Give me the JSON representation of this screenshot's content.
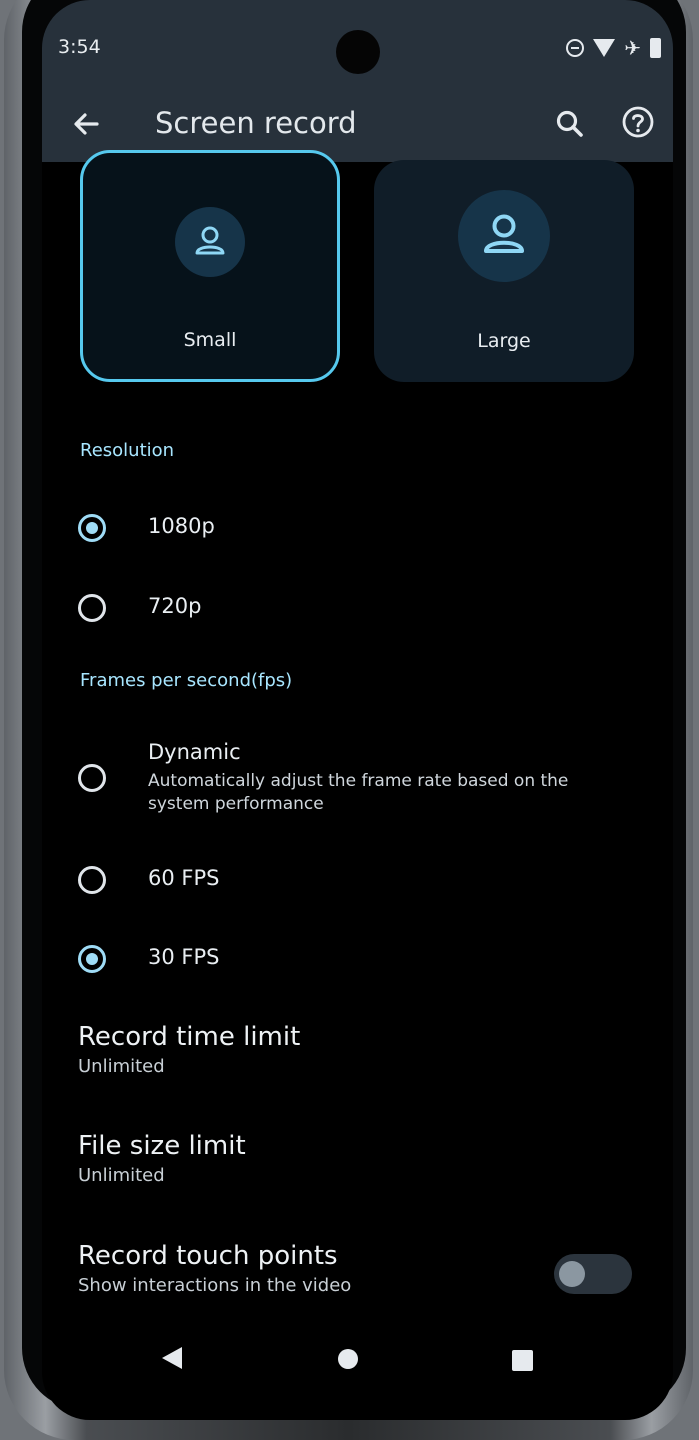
{
  "status_bar": {
    "time": "3:54",
    "icons": [
      "do-not-disturb-icon",
      "wifi-icon",
      "airplane-icon",
      "battery-icon"
    ]
  },
  "app_bar": {
    "title": "Screen record",
    "icons": [
      "back-arrow-icon",
      "search-icon",
      "help-icon"
    ]
  },
  "size_cards": [
    {
      "label": "Small",
      "selected": true
    },
    {
      "label": "Large",
      "selected": false
    }
  ],
  "resolution": {
    "heading": "Resolution",
    "options": [
      {
        "label": "1080p",
        "selected": true
      },
      {
        "label": "720p",
        "selected": false
      }
    ]
  },
  "fps": {
    "heading": "Frames per second(fps)",
    "options": [
      {
        "label": "Dynamic",
        "sub": "Automatically adjust the frame rate based on the system performance",
        "selected": false
      },
      {
        "label": "60 FPS",
        "selected": false
      },
      {
        "label": "30 FPS",
        "selected": true
      }
    ]
  },
  "record_time_limit": {
    "title": "Record time limit",
    "value": "Unlimited"
  },
  "file_size_limit": {
    "title": "File size limit",
    "value": "Unlimited"
  },
  "touch_points": {
    "title": "Record touch points",
    "sub": "Show interactions in the video",
    "enabled": false
  },
  "colors": {
    "accent": "#9fdcf6",
    "card_border": "#56c9ee",
    "app_bar": "#27313b"
  }
}
